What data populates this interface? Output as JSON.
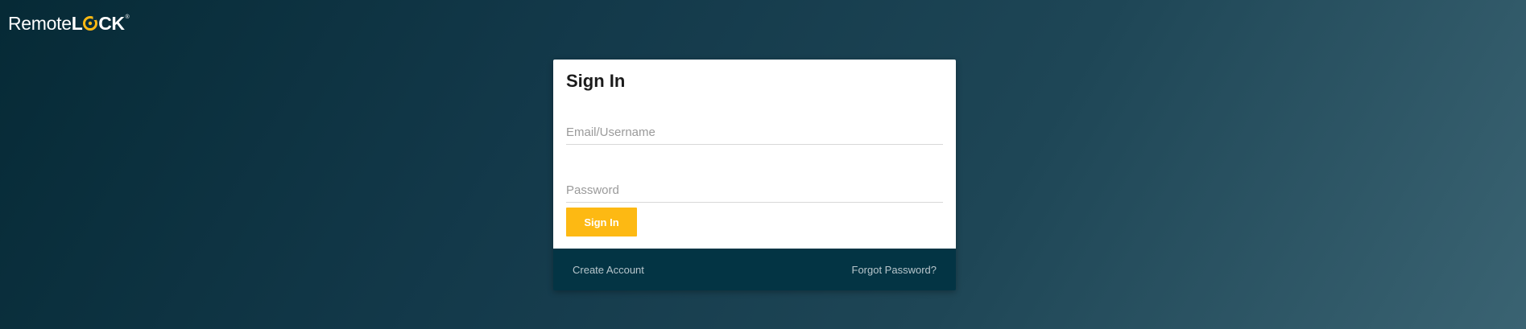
{
  "brand": {
    "name_part1": "Remote",
    "name_part2_pre": "L",
    "name_part2_post": "CK",
    "trademark": "®",
    "accent_color": "#fdb913"
  },
  "signin_card": {
    "title": "Sign In",
    "email_placeholder": "Email/Username",
    "password_placeholder": "Password",
    "submit_label": "Sign In",
    "create_account_label": "Create Account",
    "forgot_password_label": "Forgot Password?"
  },
  "colors": {
    "button": "#fdb913",
    "footer": "#033444"
  },
  "icons": {
    "logo_o": "lock-ring-icon"
  }
}
